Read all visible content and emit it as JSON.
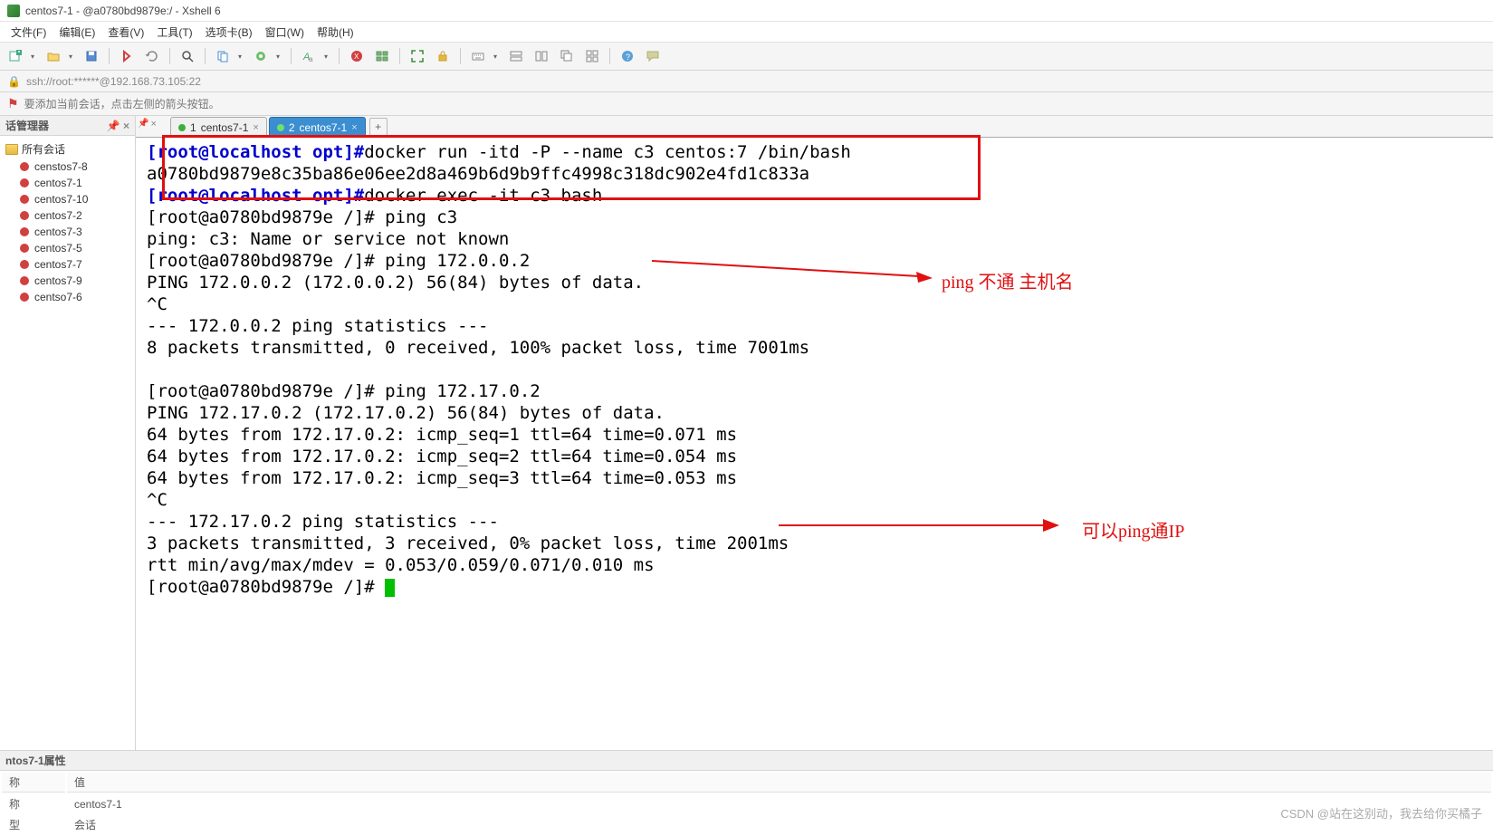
{
  "titlebar": {
    "title": "centos7-1 - @a0780bd9879e:/ - Xshell 6"
  },
  "menubar": {
    "items": [
      "文件(F)",
      "编辑(E)",
      "查看(V)",
      "工具(T)",
      "选项卡(B)",
      "窗口(W)",
      "帮助(H)"
    ]
  },
  "addressbar": {
    "url": "ssh://root:******@192.168.73.105:22"
  },
  "hintbar": {
    "text": "要添加当前会话，点击左侧的箭头按钮。"
  },
  "sidebar": {
    "panel_title": "话管理器",
    "root": "所有会话",
    "items": [
      "censtos7-8",
      "centos7-1",
      "centos7-10",
      "centos7-2",
      "centos7-3",
      "centos7-5",
      "centos7-7",
      "centos7-9",
      "centso7-6"
    ]
  },
  "tabs": {
    "items": [
      {
        "num": "1",
        "label": "centos7-1",
        "active": false
      },
      {
        "num": "2",
        "label": "centos7-1",
        "active": true
      }
    ]
  },
  "terminal": {
    "p1_user": "[root@localhost opt]#",
    "cmd1": "docker run -itd -P --name c3 centos:7 /bin/bash",
    "hash": "a0780bd9879e8c35ba86e06ee2d8a469b6d9b9ffc4998c318dc902e4fd1c833a",
    "p2_user": "[root@localhost opt]#",
    "cmd2": "docker exec -it c3 bash",
    "inner_prompt": "[root@a0780bd9879e /]# ",
    "ping_c3": "ping c3",
    "ping_err": "ping: c3: Name or service not known",
    "ping_ip1": "ping 172.0.0.2",
    "ping_hdr1": "PING 172.0.0.2 (172.0.0.2) 56(84) bytes of data.",
    "ctrlc": "^C",
    "stats1a": "--- 172.0.0.2 ping statistics ---",
    "stats1b": "8 packets transmitted, 0 received, 100% packet loss, time 7001ms",
    "ping_ip2": "ping 172.17.0.2",
    "ping_hdr2": "PING 172.17.0.2 (172.17.0.2) 56(84) bytes of data.",
    "resp1": "64 bytes from 172.17.0.2: icmp_seq=1 ttl=64 time=0.071 ms",
    "resp2": "64 bytes from 172.17.0.2: icmp_seq=2 ttl=64 time=0.054 ms",
    "resp3": "64 bytes from 172.17.0.2: icmp_seq=3 ttl=64 time=0.053 ms",
    "stats2a": "--- 172.17.0.2 ping statistics ---",
    "stats2b": "3 packets transmitted, 3 received, 0% packet loss, time 2001ms",
    "stats2c": "rtt min/avg/max/mdev = 0.053/0.059/0.071/0.010 ms"
  },
  "annotations": {
    "a1": "ping 不通 主机名",
    "a2": "可以ping通IP"
  },
  "props": {
    "title": "ntos7-1属性",
    "h1": "称",
    "h2": "值",
    "r1k": "称",
    "r1v": "centos7-1",
    "r2k": "型",
    "r2v": "会话"
  },
  "watermark": "CSDN @站在这别动，我去给你买橘子"
}
